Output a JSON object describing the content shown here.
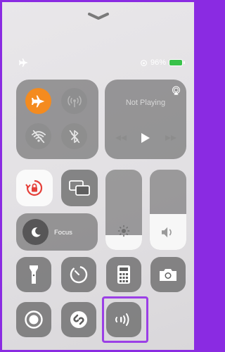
{
  "status": {
    "battery_percent": "96%",
    "icons": [
      "airplane-icon",
      "orientation-lock-status-icon",
      "battery-charging-icon"
    ]
  },
  "connectivity": {
    "airplane_mode": true,
    "cellular_data": false,
    "wifi": false,
    "bluetooth": false
  },
  "now_playing": {
    "title": "Not Playing",
    "icons": [
      "airplay-icon",
      "rewind-icon",
      "play-icon",
      "fast-forward-icon"
    ]
  },
  "focus": {
    "label": "Focus"
  },
  "sliders": {
    "brightness_level": 0.18,
    "volume_level": 0.45
  },
  "controls": [
    "orientation-lock-icon",
    "screen-mirroring-icon",
    "flashlight-icon",
    "timer-icon",
    "calculator-icon",
    "camera-icon",
    "screen-record-icon",
    "shazam-icon",
    "sound-recognition-icon"
  ],
  "colors": {
    "accent_orange": "#f48b1f",
    "highlight": "#9b3fe6",
    "lock_red": "#e5403a",
    "battery_green": "#39c24a"
  }
}
